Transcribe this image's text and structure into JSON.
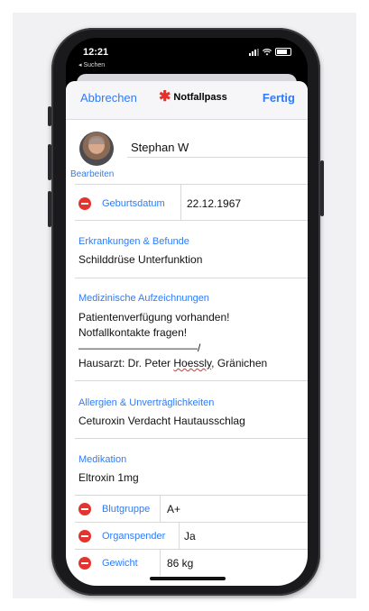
{
  "status_bar": {
    "time": "12:21",
    "back_label": "◂ Suchen"
  },
  "nav": {
    "cancel": "Abbrechen",
    "title": "Notfallpass",
    "done": "Fertig"
  },
  "profile": {
    "name": "Stephan W",
    "edit": "Bearbeiten"
  },
  "birthdate": {
    "label": "Geburtsdatum",
    "value": "22.12.1967"
  },
  "conditions": {
    "title": "Erkrankungen & Befunde",
    "text": "Schilddrüse Unterfunktion"
  },
  "medical_notes": {
    "title": "Medizinische Aufzeichnungen",
    "lines": [
      "Patientenverfügung vorhanden!",
      "Notfallkontakte fragen!",
      "———————————/"
    ],
    "doctor_prefix": "Hausarzt: Dr. Peter ",
    "doctor_surname": "Hoessly",
    "doctor_suffix": ", Gränichen"
  },
  "allergies": {
    "title": "Allergien & Unverträglichkeiten",
    "text": "Ceturoxin Verdacht Hautausschlag"
  },
  "medication": {
    "title": "Medikation",
    "text": "Eltroxin 1mg"
  },
  "blood_type": {
    "label": "Blutgruppe",
    "value": "A+"
  },
  "organ_donor": {
    "label": "Organspender",
    "value": "Ja"
  },
  "weight": {
    "label": "Gewicht",
    "value": "86 kg"
  },
  "colors": {
    "accent": "#2f7cf6",
    "delete": "#e5342e",
    "star": "#e8302a"
  }
}
